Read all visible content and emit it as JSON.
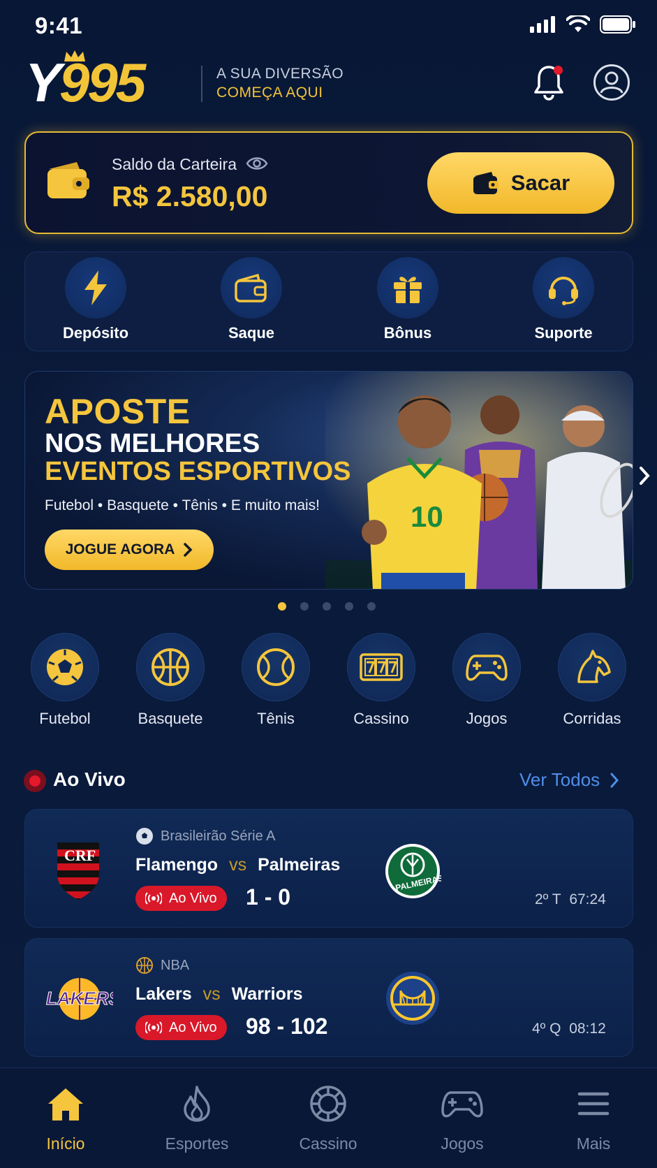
{
  "status_bar": {
    "time": "9:41"
  },
  "header": {
    "logo_y": "Y",
    "logo_num": "995",
    "tagline_line1": "A SUA DIVERSÃO",
    "tagline_line2": "COMEÇA AQUI"
  },
  "wallet": {
    "label": "Saldo da Carteira",
    "balance": "R$ 2.580,00",
    "withdraw_label": "Sacar"
  },
  "quick_actions": [
    {
      "label": "Depósito",
      "icon": "lightning-icon"
    },
    {
      "label": "Saque",
      "icon": "wallet-icon"
    },
    {
      "label": "Bônus",
      "icon": "gift-icon"
    },
    {
      "label": "Suporte",
      "icon": "headset-icon"
    }
  ],
  "banner": {
    "title1": "APOSTE",
    "title2": "NOS MELHORES",
    "title3": "EVENTOS ESPORTIVOS",
    "subtitle": "Futebol • Basquete • Tênis • E muito mais!",
    "cta": "JOGUE AGORA",
    "slide_count": 5,
    "active_slide": 1
  },
  "categories": [
    {
      "label": "Futebol",
      "icon": "soccer-ball-icon"
    },
    {
      "label": "Basquete",
      "icon": "basketball-icon"
    },
    {
      "label": "Tênis",
      "icon": "tennis-ball-icon"
    },
    {
      "label": "Cassino",
      "icon": "slot-777-icon"
    },
    {
      "label": "Jogos",
      "icon": "gamepad-icon"
    },
    {
      "label": "Corridas",
      "icon": "horse-icon"
    }
  ],
  "live": {
    "title": "Ao Vivo",
    "see_all": "Ver Todos",
    "matches": [
      {
        "league": "Brasileirão Série A",
        "home": "Flamengo",
        "vs": "vs",
        "away": "Palmeiras",
        "badge": "Ao Vivo",
        "score": "1 - 0",
        "period": "2º T",
        "clock": "67:24"
      },
      {
        "league": "NBA",
        "home": "Lakers",
        "vs": "vs",
        "away": "Warriors",
        "badge": "Ao Vivo",
        "score": "98 - 102",
        "period": "4º Q",
        "clock": "08:12"
      }
    ]
  },
  "bottom_nav": [
    {
      "label": "Início",
      "icon": "home-icon",
      "active": true
    },
    {
      "label": "Esportes",
      "icon": "flame-icon",
      "active": false
    },
    {
      "label": "Cassino",
      "icon": "casino-chip-icon",
      "active": false
    },
    {
      "label": "Jogos",
      "icon": "gamepad-icon",
      "active": false
    },
    {
      "label": "Mais",
      "icon": "menu-icon",
      "active": false
    }
  ],
  "colors": {
    "accent_gold": "#f4c53d",
    "live_red": "#d9182a",
    "link_blue": "#4f8ee8",
    "background": "#0a1a3a"
  }
}
